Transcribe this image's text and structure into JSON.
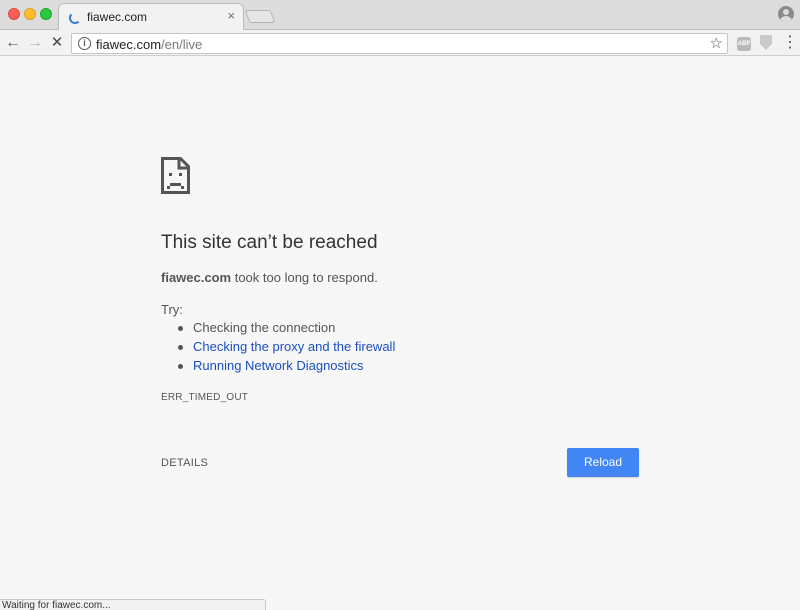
{
  "window": {
    "tab": {
      "title": "fiawec.com",
      "close_glyph": "×"
    }
  },
  "toolbar": {
    "back_glyph": "←",
    "forward_glyph": "→",
    "stop_glyph": "✕",
    "url_host": "fiawec.com",
    "url_path": "/en/live",
    "star_glyph": "☆",
    "abp_label": "ABP",
    "menu_glyph": "⋮",
    "icons": [
      "info-icon",
      "star-icon",
      "adblock-plus-icon",
      "shield-extension-icon",
      "menu-icon"
    ]
  },
  "error_page": {
    "headline": "This site can’t be reached",
    "host": "fiawec.com",
    "message_rest": " took too long to respond.",
    "try_label": "Try:",
    "suggestions": [
      "Checking the connection",
      "Checking the proxy and the firewall",
      "Running Network Diagnostics"
    ],
    "error_code": "ERR_TIMED_OUT",
    "details_label": "DETAILS",
    "reload_label": "Reload"
  },
  "status": {
    "text": "Waiting for fiawec.com..."
  },
  "colors": {
    "page_background": "#f7f7f7",
    "accent_button": "#4285f4",
    "link": "#1a4fc2",
    "text": "#555555"
  }
}
